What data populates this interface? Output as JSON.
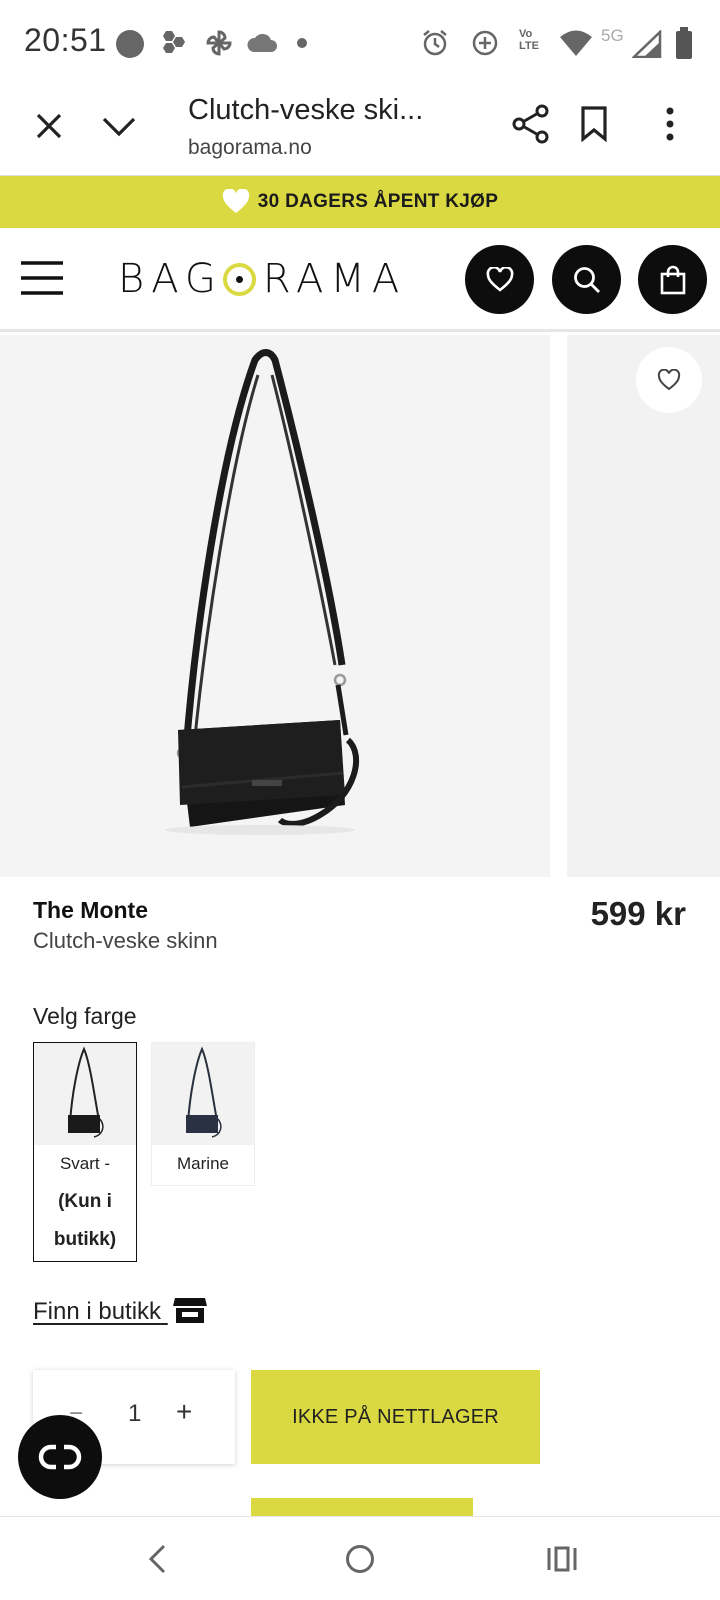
{
  "status_bar": {
    "time": "20:51",
    "network": "5G",
    "volte": "Vo LTE",
    "notification_icons": [
      "coop-icon",
      "hexagons-icon",
      "pinwheel-icon",
      "cloud-icon",
      "dot-icon"
    ],
    "system_icons": [
      "alarm-icon",
      "data-saver-icon",
      "volte-icon",
      "wifi-icon",
      "signal-icon",
      "battery-icon"
    ]
  },
  "browser": {
    "title": "Clutch-veske ski...",
    "url": "bagorama.no"
  },
  "promo": {
    "text": "30 DAGERS ÅPENT KJØP"
  },
  "header": {
    "logo_before": "BAG",
    "logo_after": "RAMA"
  },
  "product": {
    "brand": "The Monte",
    "subtitle": "Clutch-veske skinn",
    "price": "599 kr"
  },
  "colors": {
    "heading": "Velg farge",
    "options": [
      {
        "label": "Svart -",
        "note": "(Kun i butikk)",
        "selected": true
      },
      {
        "label": "Marine",
        "note": "",
        "selected": false
      }
    ]
  },
  "store_link": "Finn i butikk",
  "quantity": {
    "minus": "−",
    "value": "1",
    "plus": "+"
  },
  "cta": {
    "label": "IKKE PÅ NETTLAGER"
  },
  "theme": {
    "accent": "#dad941",
    "dark": "#0d0d0d"
  }
}
